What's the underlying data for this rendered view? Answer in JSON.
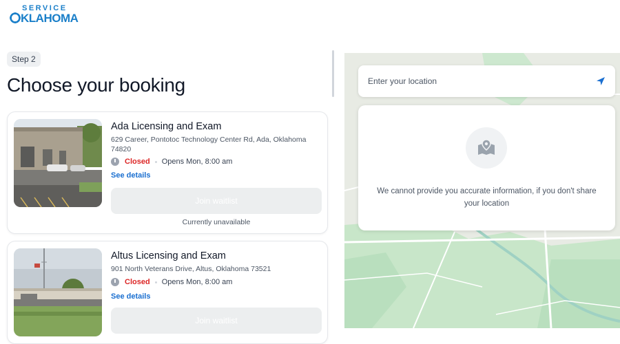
{
  "header": {
    "logo_top": "SERVICE",
    "logo_bottom": "KLAHOMA"
  },
  "booking": {
    "step": "Step 2",
    "heading": "Choose your booking"
  },
  "locations": [
    {
      "name": "Ada Licensing and Exam",
      "address": "629 Career, Pontotoc Technology Center Rd, Ada, Oklahoma 74820",
      "status": "Closed",
      "hours": "Opens Mon, 8:00 am",
      "details_label": "See details",
      "waitlist_label": "Join waitlist",
      "availability": "Currently unavailable"
    },
    {
      "name": "Altus Licensing and Exam",
      "address": "901 North Veterans Drive, Altus, Oklahoma 73521",
      "status": "Closed",
      "hours": "Opens Mon, 8:00 am",
      "details_label": "See details",
      "waitlist_label": "Join waitlist"
    }
  ],
  "map": {
    "search_placeholder": "Enter your location",
    "location_message": "We cannot provide you accurate information, if you don't share your location"
  }
}
